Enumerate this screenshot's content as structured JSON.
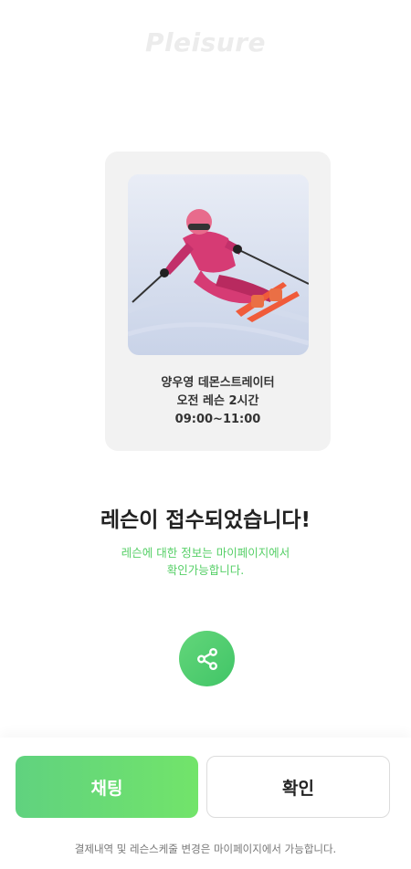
{
  "header": {
    "logo_text": "Pleisure"
  },
  "lesson_card": {
    "image": "skier-photo",
    "instructor": "양우영 데몬스트레이터",
    "lesson": "오전 레슨 2시간",
    "time": "09:00~11:00"
  },
  "status": {
    "title": "레슨이 접수되었습니다!",
    "subtitle_line1": "레슨에 대한 정보는 마이페이지에서",
    "subtitle_line2": "확인가능합니다."
  },
  "share": {
    "icon": "share-icon"
  },
  "actions": {
    "chat_label": "채팅",
    "confirm_label": "확인",
    "footnote": "결제내역 및 레슨스케줄 변경은 마이페이지에서 가능합니다."
  },
  "colors": {
    "accent": "#5fd16f",
    "card_bg": "#f2f2f2"
  }
}
